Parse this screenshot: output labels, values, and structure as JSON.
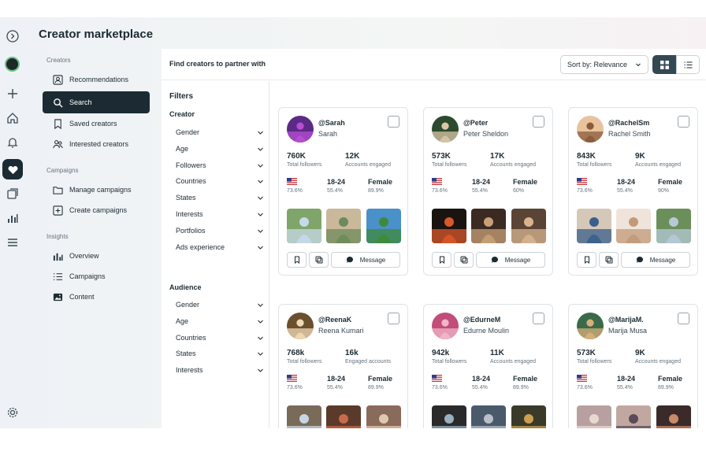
{
  "page": {
    "title": "Creator marketplace"
  },
  "sidenav": {
    "sections": [
      {
        "label": "Creators",
        "items": [
          {
            "label": "Recommendations",
            "icon": "recommendations-icon"
          },
          {
            "label": "Search",
            "icon": "search-icon",
            "active": true
          },
          {
            "label": "Saved creators",
            "icon": "bookmark-icon"
          },
          {
            "label": "Interested creators",
            "icon": "users-icon"
          }
        ]
      },
      {
        "label": "Campaigns",
        "items": [
          {
            "label": "Manage campaigns",
            "icon": "folder-icon"
          },
          {
            "label": "Create campaigns",
            "icon": "plus-square-icon"
          }
        ]
      },
      {
        "label": "Insights",
        "items": [
          {
            "label": "Overview",
            "icon": "bar-chart-icon"
          },
          {
            "label": "Campaigns",
            "icon": "list-icon"
          },
          {
            "label": "Content",
            "icon": "image-icon"
          }
        ]
      }
    ]
  },
  "main": {
    "title": "Find creators to partner with",
    "sort_label": "Sort by: Relevance"
  },
  "filters": {
    "title": "Filters",
    "creator": {
      "title": "Creator",
      "items": [
        "Gender",
        "Age",
        "Followers",
        "Countries",
        "States",
        "Interests",
        "Portfolios",
        "Ads experience"
      ]
    },
    "audience": {
      "title": "Audience",
      "items": [
        "Gender",
        "Age",
        "Countries",
        "States",
        "Interests"
      ]
    }
  },
  "cards": [
    {
      "handle": "@Sarah",
      "name": "Sarah",
      "followers": "760K",
      "followers_label": "Total followers",
      "engaged": "12K",
      "engaged_label": "Accounts engaged",
      "country_pct": "73.6%",
      "age": "18-24",
      "age_pct": "55.4%",
      "gender": "Female",
      "gender_pct": "89.9%",
      "message": "Message"
    },
    {
      "handle": "@Peter",
      "name": "Peter Sheldon",
      "followers": "573K",
      "followers_label": "Total followers",
      "engaged": "17K",
      "engaged_label": "Accounts engaged",
      "country_pct": "73.6%",
      "age": "18-24",
      "age_pct": "55.4%",
      "gender": "Female",
      "gender_pct": "60%",
      "message": "Message"
    },
    {
      "handle": "@RachelSm",
      "name": "Rachel Smith",
      "followers": "843K",
      "followers_label": "Total followers",
      "engaged": "9K",
      "engaged_label": "Accounts engaged",
      "country_pct": "73.6%",
      "age": "18-24",
      "age_pct": "55.4%",
      "gender": "Female",
      "gender_pct": "90%",
      "message": "Message"
    },
    {
      "handle": "@ReenaK",
      "name": "Reena Kumari",
      "followers": "768k",
      "followers_label": "Total followers",
      "engaged": "16k",
      "engaged_label": "Engaged accounts",
      "country_pct": "73.6%",
      "age": "18-24",
      "age_pct": "55.4%",
      "gender": "Female",
      "gender_pct": "89.9%",
      "message": "Message"
    },
    {
      "handle": "@EdurneM",
      "name": "Edurne Moulin",
      "followers": "942k",
      "followers_label": "Total followers",
      "engaged": "11K",
      "engaged_label": "Accounts engaged",
      "country_pct": "73.6%",
      "age": "18-24",
      "age_pct": "55.4%",
      "gender": "Female",
      "gender_pct": "89.9%",
      "message": "Message"
    },
    {
      "handle": "@MarijaM.",
      "name": "Marija Musa",
      "followers": "573K",
      "followers_label": "Total followers",
      "engaged": "9K",
      "engaged_label": "Accounts engaged",
      "country_pct": "73.6%",
      "age": "18-24",
      "age_pct": "55.4%",
      "gender": "Female",
      "gender_pct": "89.9%",
      "message": "Message"
    }
  ],
  "colors": {
    "primary_dark": "#1c2b33",
    "border": "#dfe3e7",
    "muted": "#65737e"
  }
}
